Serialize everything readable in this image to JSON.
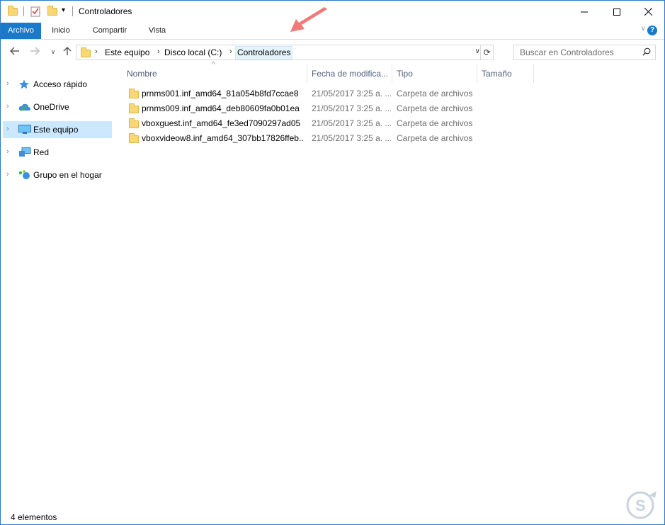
{
  "window": {
    "title": "Controladores"
  },
  "ribbon": {
    "tabs": [
      "Archivo",
      "Inicio",
      "Compartir",
      "Vista"
    ],
    "active_tab": "Archivo",
    "help_label": "?"
  },
  "nav": {
    "breadcrumbs": [
      "Este equipo",
      "Disco local (C:)",
      "Controladores"
    ],
    "search_placeholder": "Buscar en Controladores"
  },
  "sidebar": {
    "items": [
      {
        "label": "Acceso rápido",
        "icon": "star-icon"
      },
      {
        "label": "OneDrive",
        "icon": "cloud-icon"
      },
      {
        "label": "Este equipo",
        "icon": "monitor-icon",
        "selected": true
      },
      {
        "label": "Red",
        "icon": "network-icon"
      },
      {
        "label": "Grupo en el hogar",
        "icon": "homegroup-icon"
      }
    ]
  },
  "columns": [
    "Nombre",
    "Fecha de modifica...",
    "Tipo",
    "Tamaño"
  ],
  "files": [
    {
      "name": "prnms001.inf_amd64_81a054b8fd7ccae8",
      "date": "21/05/2017 3:25 a. ...",
      "type": "Carpeta de archivos"
    },
    {
      "name": "prnms009.inf_amd64_deb80609fa0b01ea",
      "date": "21/05/2017 3:25 a. ...",
      "type": "Carpeta de archivos"
    },
    {
      "name": "vboxguest.inf_amd64_fe3ed7090297ad05",
      "date": "21/05/2017 3:25 a. ...",
      "type": "Carpeta de archivos"
    },
    {
      "name": "vboxvideow8.inf_amd64_307bb17826ffeb...",
      "date": "21/05/2017 3:25 a. ...",
      "type": "Carpeta de archivos"
    }
  ],
  "status": {
    "count": "4 elementos"
  },
  "colors": {
    "accent": "#1979ca",
    "selection": "#cce8ff",
    "annotation_arrow": "#f07a78"
  }
}
